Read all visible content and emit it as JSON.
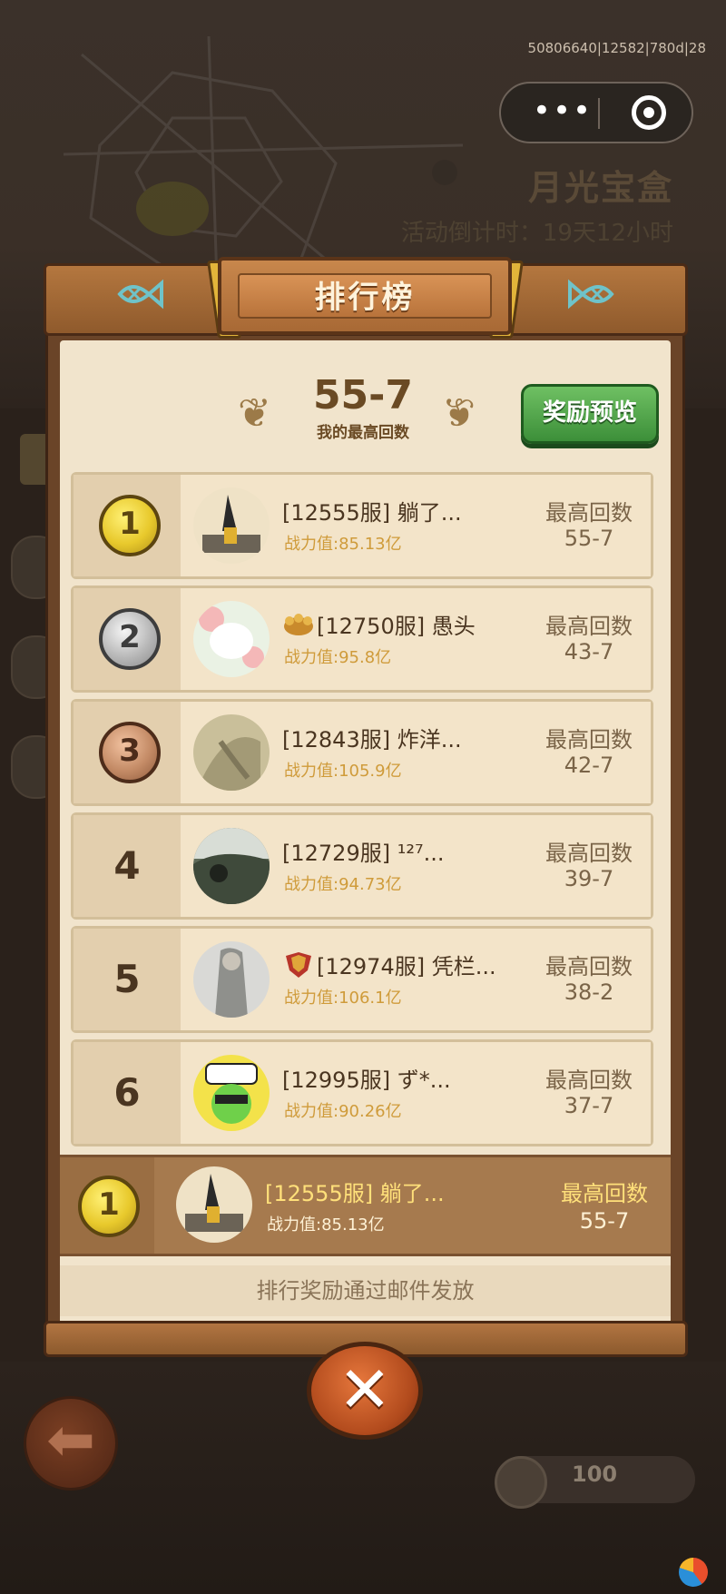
{
  "system": {
    "debug_id": "50806640|12582|780d|28",
    "more_glyph": "•••",
    "close_glyph": ""
  },
  "background": {
    "event_title": "月光宝盒",
    "countdown": "活动倒计时：19天12小时",
    "coin_value": "100"
  },
  "panel": {
    "title": "排行榜",
    "best_score": "55-7",
    "best_label": "我的最高回数",
    "reward_button": "奖励预览",
    "score_label": "最高回数",
    "footer_notice": "排行奖励通过邮件发放",
    "close_glyph": "✕"
  },
  "rows": [
    {
      "rank": "1",
      "medal": "gold",
      "name": "[12555服] 躺了...",
      "power": "战力值:85.13亿",
      "score": "55-7"
    },
    {
      "rank": "2",
      "medal": "silver",
      "name": "[12750服] 愚头",
      "power": "战力值:95.8亿",
      "score": "43-7"
    },
    {
      "rank": "3",
      "medal": "bronze",
      "name": "[12843服] 炸洋...",
      "power": "战力值:105.9亿",
      "score": "42-7"
    },
    {
      "rank": "4",
      "medal": "",
      "name": "[12729服] ¹²⁷...",
      "power": "战力值:94.73亿",
      "score": "39-7"
    },
    {
      "rank": "5",
      "medal": "",
      "name": "[12974服] 凭栏...",
      "power": "战力值:106.1亿",
      "score": "38-2"
    },
    {
      "rank": "6",
      "medal": "",
      "name": "[12995服] ず*...",
      "power": "战力值:90.26亿",
      "score": "37-7"
    }
  ],
  "my_rank": {
    "rank": "1",
    "name": "[12555服] 躺了...",
    "power": "战力值:85.13亿",
    "score": "55-7"
  },
  "colors": {
    "accent_green": "#4fa546",
    "wood": "#8f5a2c",
    "parchment": "#f1e4cc"
  }
}
